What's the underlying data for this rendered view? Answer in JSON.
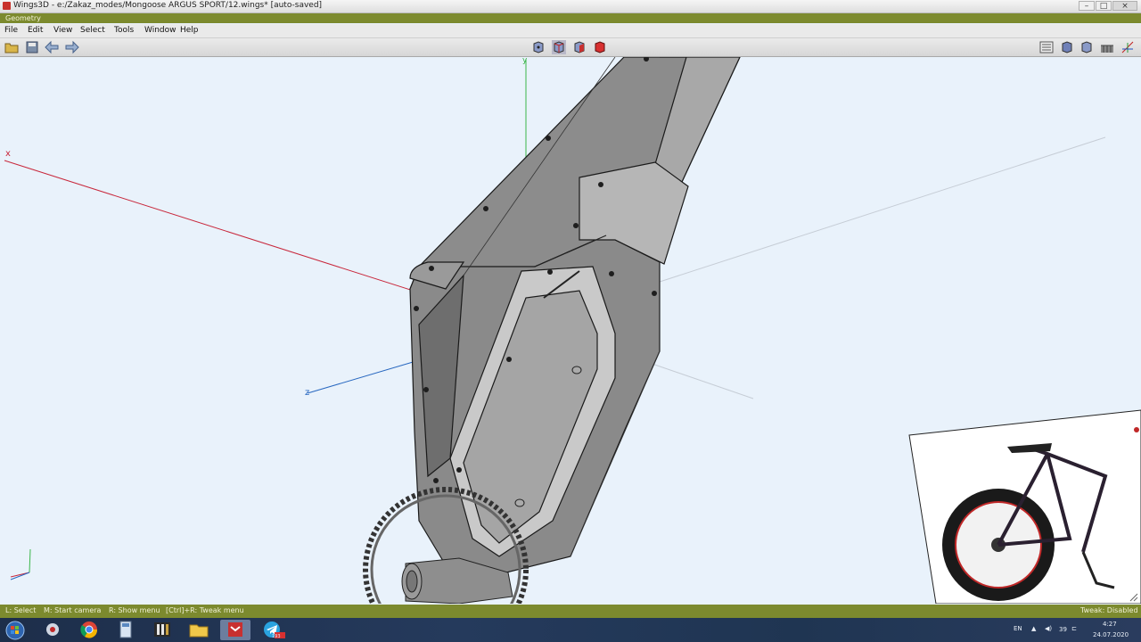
{
  "window": {
    "title": "Wings3D - e:/Zakaz_modes/Mongoose ARGUS SPORT/12.wings* [auto-saved]",
    "controls": [
      "–",
      "□",
      "×"
    ]
  },
  "geometry_bar": {
    "label": "Geometry"
  },
  "menu": [
    "File",
    "Edit",
    "View",
    "Select",
    "Tools",
    "Window",
    "Help"
  ],
  "toolbar": {
    "left_icons": [
      "open-folder-icon",
      "save-icon",
      "undo-arrow-icon",
      "redo-arrow-icon"
    ],
    "center_icons": [
      "vertex-mode-icon",
      "edge-mode-icon",
      "face-mode-icon",
      "body-mode-icon"
    ],
    "right_icons": [
      "outliner-icon",
      "shaded-view-icon",
      "smooth-preview-icon",
      "wireframe-icon",
      "axes-icon"
    ]
  },
  "viewport": {
    "axis_labels": {
      "x": "x",
      "y": "y",
      "z": "z"
    },
    "axis_colors": {
      "x": "#c8283c",
      "y": "#3ab64a",
      "z": "#2868c0"
    },
    "background": "#e9f2fb",
    "model_color": "#8a8a8a",
    "reference_image": "mountain-bike-photo"
  },
  "statusbar": {
    "hints": [
      "L: Select",
      "M: Start camera",
      "R: Show menu",
      "[Ctrl]+R: Tweak menu"
    ],
    "tweak": "Tweak: Disabled"
  },
  "taskbar": {
    "apps": [
      "start-button",
      "agent-app",
      "chrome",
      "calculator",
      "video-app",
      "file-explorer",
      "wings3d",
      "telegram"
    ],
    "telegram_badge": "193",
    "tray": {
      "lang": "EN",
      "temp": "39",
      "time": "4:27",
      "date": "24.07.2020"
    }
  }
}
